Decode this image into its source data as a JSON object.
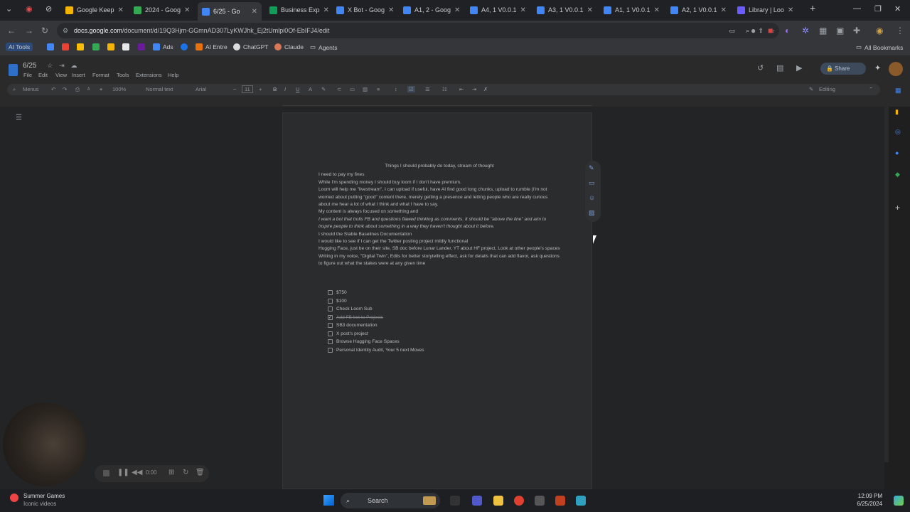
{
  "browser": {
    "tabs": [
      {
        "label": "Google Keep",
        "color": "#f4b400"
      },
      {
        "label": "2024 - Goog",
        "color": "#34a853"
      },
      {
        "label": "6/25 - Go",
        "color": "#4285f4",
        "active": true
      },
      {
        "label": "Business Exp",
        "color": "#0f9d58"
      },
      {
        "label": "X Bot - Goog",
        "color": "#4285f4"
      },
      {
        "label": "A1, 2 - Goog",
        "color": "#4285f4"
      },
      {
        "label": "A4, 1 V0.0.1",
        "color": "#4285f4"
      },
      {
        "label": "A3, 1 V0.0.1",
        "color": "#4285f4"
      },
      {
        "label": "A1, 1 V0.0.1",
        "color": "#4285f4"
      },
      {
        "label": "A2, 1 V0.0.1",
        "color": "#4285f4"
      },
      {
        "label": "Library | Loo",
        "color": "#6a5cff"
      }
    ],
    "url_host": "docs.google.com",
    "url_path": "/document/d/19Q3Hjm-GGmnAD307LyKWJhk_Ej2tUmlpi0Of-EbIFJ4/edit",
    "bookmarks": [
      "AI Tools",
      "Ads",
      "AI Entre",
      "ChatGPT",
      "Claude",
      "Agents"
    ],
    "all_bookmarks": "All Bookmarks"
  },
  "docs": {
    "title": "6/25",
    "menus": [
      "File",
      "Edit",
      "View",
      "Insert",
      "Format",
      "Tools",
      "Extensions",
      "Help"
    ],
    "toolbar": {
      "menus": "Menus",
      "zoom": "100%",
      "style": "Normal text",
      "font": "Arial",
      "size": "11",
      "mode": "Editing"
    },
    "share": "Share"
  },
  "document": {
    "heading": "Things I should probably do today, stream of thought",
    "lines": [
      {
        "text": "I need to pay my fines"
      },
      {
        "text": "While I'm spending money I should buy loom if I don't have premium.",
        "ul": true
      },
      {
        "text": "Loom will help me \"livestream\", I can upload if useful, have AI find good long chunks, upload to rumble (I'm not worried about putting \"good\" content there, merely getting a presence and letting people who are really curious about me hear a lot of what I think and what I have to say."
      },
      {
        "text": "My content is always focused on something and"
      },
      {
        "text": "I want a bot that trolls FB and questions flawed thinking as comments. It should be \"above the line\" and aim to inspire people to think about something in a way they haven't thought about it before.",
        "italic": true
      },
      {
        "text": "I should the Stable Baselines Documentation"
      },
      {
        "text": "I would like to see if I can get the Twitter posting project mildly functional"
      },
      {
        "text": "Hugging Face, just be on their site, SB doc before Lunar Lander, YT about HF project, Look at other people's spaces"
      },
      {
        "text": "Writing in my voice, \"Digital Twin\", Edits for better storytelling effect, ask for details that can add flavor, ask questions to figure out what the stakes were at any given time"
      }
    ],
    "checklist": [
      {
        "text": "$750",
        "checked": false
      },
      {
        "text": "$100",
        "checked": false
      },
      {
        "text": "Check Loom Sub",
        "checked": false
      },
      {
        "text": "Add FB bot to Projects",
        "checked": true
      },
      {
        "text": "SB3 documentation",
        "checked": false
      },
      {
        "text": "X post's project",
        "checked": false
      },
      {
        "text": "Browse Hugging Face Spaces",
        "checked": false
      },
      {
        "text": "Personal Identity Audit, Your 5 next Moves",
        "checked": false
      }
    ]
  },
  "recorder": {
    "time": "0:00"
  },
  "taskbar": {
    "weather_title": "Summer Games",
    "weather_sub": "Iconic videos",
    "search": "Search",
    "time": "12:09 PM",
    "date": "6/25/2024"
  }
}
